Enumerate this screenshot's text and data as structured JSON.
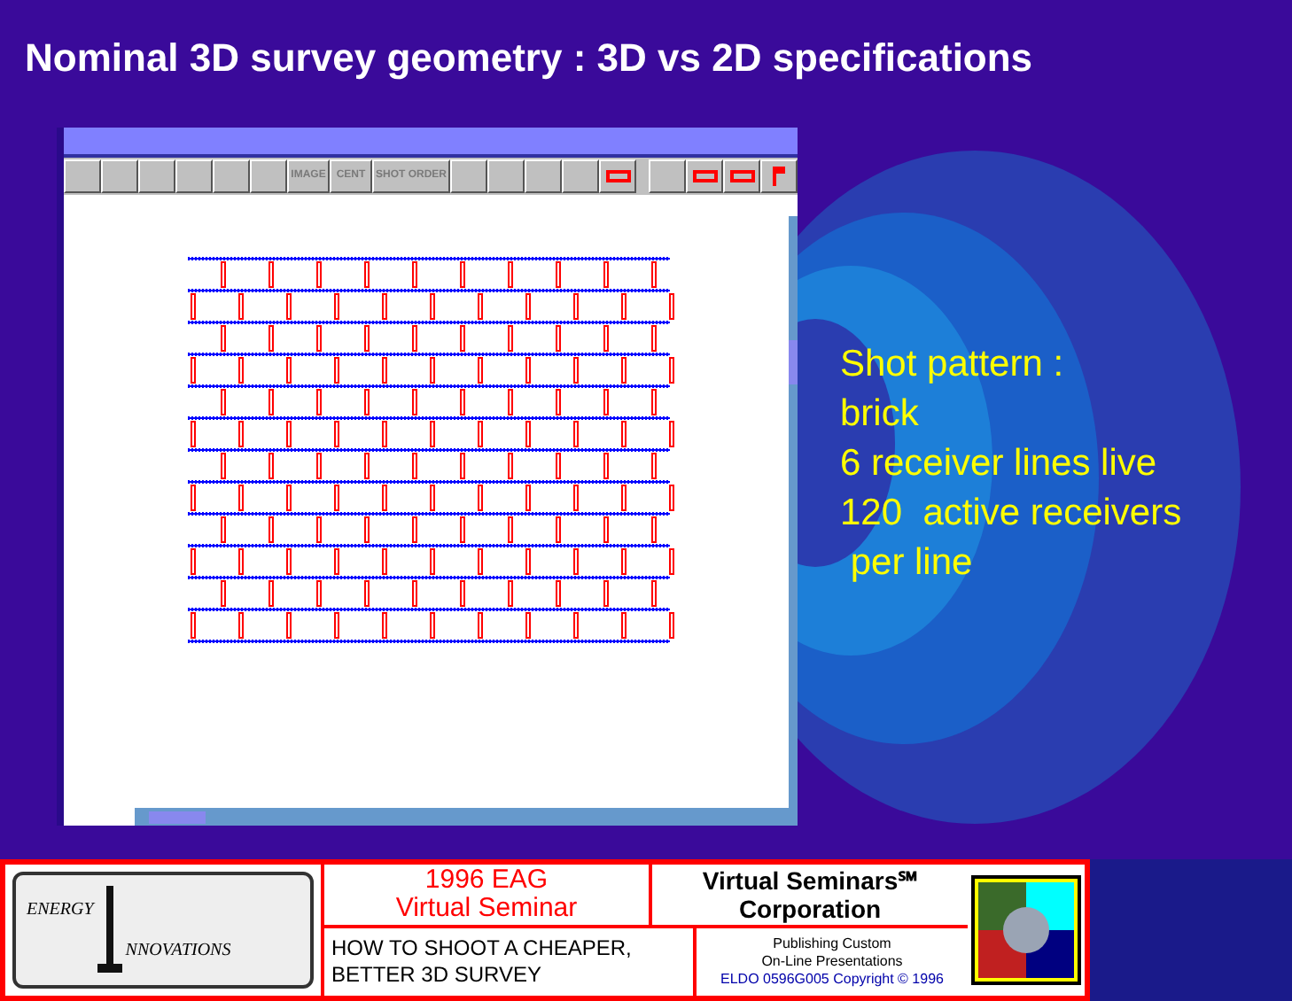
{
  "title": "Nominal 3D survey geometry : 3D vs 2D specifications",
  "window": {
    "toolbar": [
      {
        "kind": "blank"
      },
      {
        "kind": "blank"
      },
      {
        "kind": "blank"
      },
      {
        "kind": "blank"
      },
      {
        "kind": "blank"
      },
      {
        "kind": "blank"
      },
      {
        "kind": "text",
        "label": "IMAGE",
        "disabled": true
      },
      {
        "kind": "text",
        "label": "CENT",
        "disabled": true
      },
      {
        "kind": "text",
        "label": "SHOT ORDER",
        "disabled": true
      },
      {
        "kind": "blank"
      },
      {
        "kind": "blank"
      },
      {
        "kind": "blank"
      },
      {
        "kind": "blank"
      },
      {
        "kind": "red"
      }
    ],
    "toolbar_right": [
      {
        "kind": "blank"
      },
      {
        "kind": "red"
      },
      {
        "kind": "red"
      },
      {
        "kind": "flag"
      }
    ]
  },
  "notes": [
    "Shot pattern :",
    "brick",
    "6 receiver lines live",
    "120  active receivers",
    " per line"
  ],
  "footer": {
    "logo": {
      "word_1": "ENERGY",
      "word_2": "NNOVATIONS"
    },
    "event": [
      "1996 EAG",
      "Virtual Seminar"
    ],
    "course": [
      "HOW TO SHOOT A CHEAPER,",
      "BETTER 3D SURVEY"
    ],
    "company": [
      "Virtual Seminars℠",
      "Corporation"
    ],
    "tagline": [
      "Publishing Custom",
      "On-Line Presentations"
    ],
    "copyright": "ELDO 0596G005 Copyright © 1996"
  }
}
